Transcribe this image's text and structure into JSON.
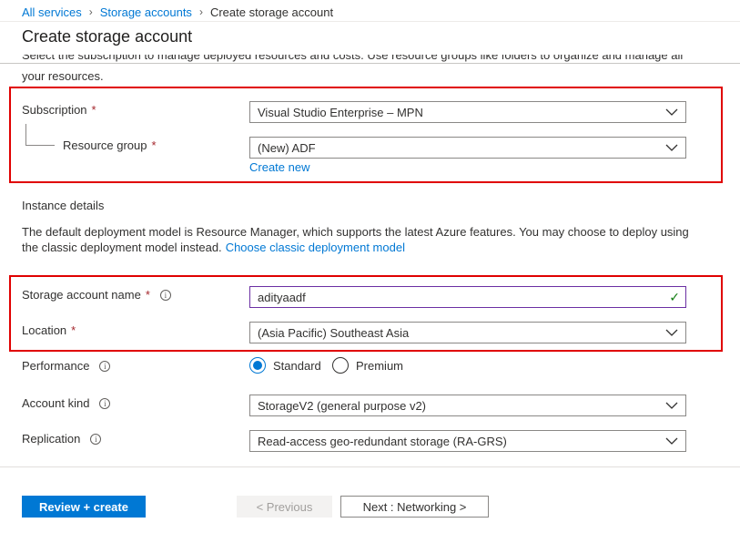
{
  "breadcrumb": {
    "items": [
      "All services",
      "Storage accounts"
    ],
    "current": "Create storage account",
    "separator": ">"
  },
  "page": {
    "title": "Create storage account",
    "clipped_text": "Select the subscription to manage deployed resources and costs. Use resource groups like folders to organize and manage all",
    "continued_text": "your resources."
  },
  "project": {
    "subscription_label": "Subscription",
    "subscription_value": "Visual Studio Enterprise – MPN",
    "resource_group_label": "Resource group",
    "resource_group_value": "(New) ADF",
    "create_new_label": "Create new",
    "required_mark": "*"
  },
  "instance": {
    "heading": "Instance details",
    "description": "The default deployment model is Resource Manager, which supports the latest Azure features. You may choose to deploy using the classic deployment model instead.",
    "classic_link": "Choose classic deployment model",
    "storage_name_label": "Storage account name",
    "storage_name_value": "adityaadf",
    "location_label": "Location",
    "location_value": "(Asia Pacific) Southeast Asia",
    "performance_label": "Performance",
    "performance_options": [
      "Standard",
      "Premium"
    ],
    "performance_selected": "Standard",
    "account_kind_label": "Account kind",
    "account_kind_value": "StorageV2 (general purpose v2)",
    "replication_label": "Replication",
    "replication_value": "Read-access geo-redundant storage (RA-GRS)",
    "info_glyph": "i",
    "valid_glyph": "✓"
  },
  "footer": {
    "review_create": "Review + create",
    "previous": "< Previous",
    "next": "Next : Networking >"
  },
  "colors": {
    "accent": "#0078d4",
    "highlight_box": "#e00000",
    "valid": "#107c10"
  }
}
